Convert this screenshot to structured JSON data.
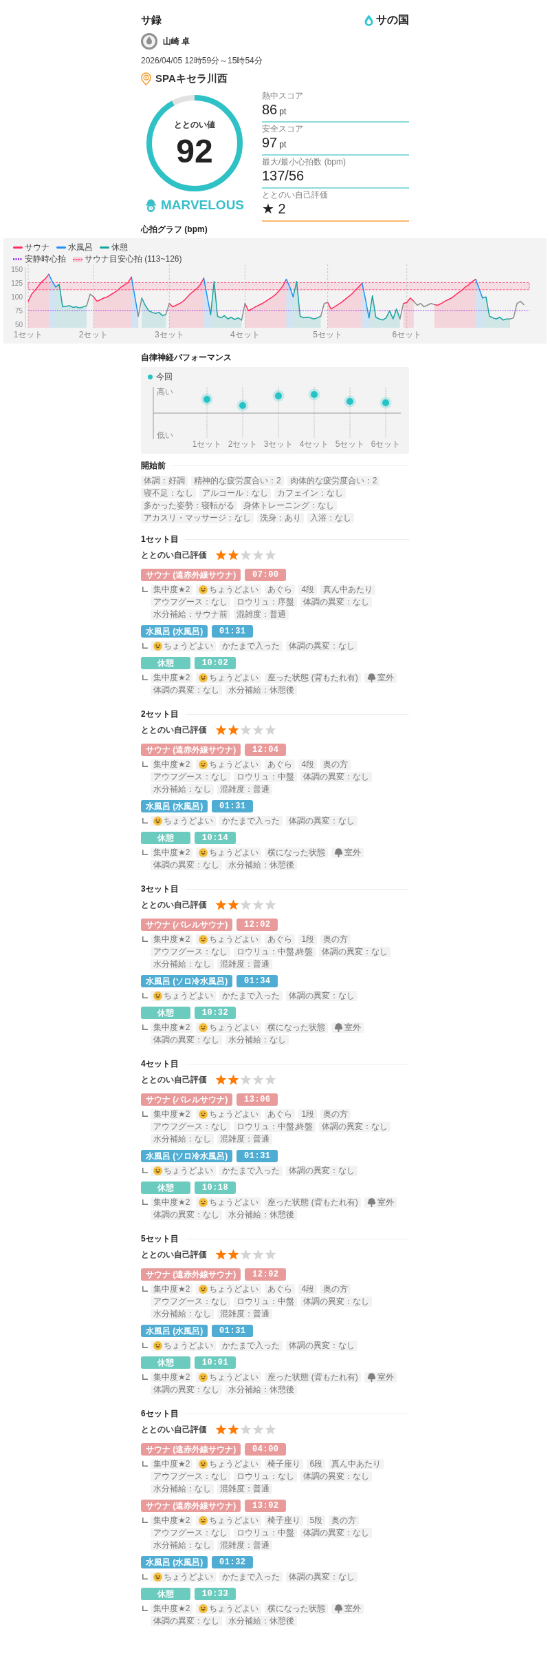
{
  "header": {
    "title": "サ録",
    "logo": "サの国"
  },
  "user": {
    "name": "山崎 卓"
  },
  "session": {
    "datetime": "2026/04/05 12時59分～15時54分",
    "facility": "SPAキセラ川西"
  },
  "score": {
    "label": "ととのい値",
    "value": "92",
    "level": 0.92,
    "rank": "MARVELOUS"
  },
  "metrics": [
    {
      "label": "熱中スコア",
      "value": "86",
      "unit": "pt",
      "color": "#8adbdc"
    },
    {
      "label": "安全スコア",
      "value": "97",
      "unit": "pt",
      "color": "#8adbdc"
    },
    {
      "label": "最大/最小心拍数 (bpm)",
      "value": "137/56",
      "color": "#8adbdc"
    },
    {
      "label": "ととのい自己評価",
      "value": "★ 2",
      "color": "#f8b86a"
    }
  ],
  "heart_rate": {
    "title": "心拍グラフ (bpm)",
    "chart_data": {
      "type": "area",
      "legend": "upper left",
      "categories": [
        "1セット",
        null,
        null,
        null,
        null,
        null,
        null,
        null,
        null,
        null,
        null,
        null,
        null,
        null,
        null,
        null,
        null,
        null,
        null,
        "2セット",
        null,
        null,
        null,
        null,
        null,
        null,
        null,
        null,
        null,
        null,
        null,
        null,
        null,
        null,
        null,
        null,
        null,
        null,
        null,
        null,
        null,
        "3セット",
        null,
        null,
        null,
        null,
        null,
        null,
        null,
        null,
        null,
        null,
        null,
        null,
        null,
        null,
        null,
        null,
        null,
        null,
        null,
        null,
        null,
        "4セット",
        null,
        null,
        null,
        null,
        null,
        null,
        null,
        null,
        null,
        null,
        null,
        null,
        null,
        null,
        null,
        null,
        null,
        null,
        null,
        null,
        null,
        null,
        null,
        "5セット",
        null,
        null,
        null,
        null,
        null,
        null,
        null,
        null,
        null,
        null,
        null,
        null,
        null,
        null,
        null,
        null,
        null,
        null,
        null,
        null,
        null,
        null,
        "6セット",
        null,
        null,
        null,
        null,
        null,
        null,
        null,
        null,
        null,
        null,
        null,
        null,
        null,
        null,
        null,
        null,
        null,
        null,
        null,
        null,
        null,
        null,
        null,
        null,
        null,
        null,
        null,
        null,
        null,
        null,
        null,
        null,
        null,
        null
      ],
      "ylim": [
        44,
        154
      ],
      "yticks": [
        50,
        75,
        100,
        125,
        150
      ],
      "series": [
        {
          "name": "サウナ",
          "color": "#ff2d5f",
          "values": [
            92,
            105,
            112,
            120,
            128,
            133,
            141,
            null,
            null,
            null,
            null,
            null,
            null,
            null,
            null,
            null,
            null,
            null,
            null,
            100,
            92,
            95,
            98,
            100,
            104,
            108,
            112,
            118,
            122,
            126,
            136,
            null,
            null,
            null,
            null,
            null,
            null,
            null,
            null,
            null,
            null,
            88,
            82,
            85,
            88,
            92,
            98,
            105,
            110,
            115,
            122,
            134,
            null,
            null,
            null,
            null,
            null,
            null,
            null,
            null,
            null,
            null,
            null,
            88,
            75,
            78,
            82,
            85,
            88,
            92,
            96,
            100,
            105,
            112,
            120,
            132,
            null,
            null,
            null,
            null,
            null,
            null,
            null,
            null,
            null,
            null,
            null,
            90,
            78,
            82,
            86,
            90,
            95,
            100,
            105,
            112,
            118,
            125,
            null,
            null,
            null,
            null,
            null,
            null,
            null,
            null,
            null,
            null,
            null,
            88,
            90,
            98,
            92,
            null,
            null,
            null,
            null,
            null,
            86,
            85,
            88,
            92,
            95,
            98,
            103,
            108,
            112,
            118,
            122,
            128,
            132,
            null,
            null,
            null,
            null,
            null,
            null,
            null,
            null,
            null,
            null,
            null,
            null,
            null,
            null
          ]
        },
        {
          "name": "水風呂",
          "color": "#1e8ff5",
          "values": [
            null,
            null,
            null,
            null,
            null,
            null,
            141,
            128,
            118,
            null,
            null,
            null,
            null,
            null,
            null,
            null,
            null,
            null,
            null,
            null,
            null,
            null,
            null,
            null,
            null,
            null,
            null,
            null,
            null,
            null,
            136,
            100,
            65,
            null,
            null,
            null,
            null,
            null,
            null,
            null,
            null,
            null,
            null,
            null,
            null,
            null,
            null,
            null,
            null,
            null,
            null,
            134,
            100,
            68,
            null,
            null,
            null,
            null,
            null,
            null,
            null,
            null,
            null,
            null,
            null,
            null,
            null,
            null,
            null,
            null,
            null,
            null,
            null,
            null,
            null,
            132,
            118,
            100,
            null,
            null,
            null,
            null,
            null,
            null,
            null,
            null,
            null,
            null,
            null,
            null,
            null,
            null,
            null,
            null,
            null,
            null,
            null,
            125,
            95,
            62,
            null,
            null,
            null,
            null,
            null,
            null,
            null,
            null,
            null,
            null,
            null,
            null,
            null,
            null,
            null,
            null,
            null,
            null,
            null,
            null,
            null,
            null,
            null,
            null,
            null,
            null,
            null,
            null,
            null,
            null,
            132,
            115,
            98,
            null,
            null,
            null,
            null,
            null,
            null,
            null,
            null,
            null,
            null,
            null,
            null
          ]
        },
        {
          "name": "休憩",
          "color": "#17a39f",
          "values": [
            null,
            null,
            null,
            null,
            null,
            null,
            null,
            null,
            118,
            123,
            82,
            83,
            84,
            81,
            82,
            80,
            82,
            84,
            null,
            null,
            null,
            null,
            null,
            null,
            null,
            null,
            null,
            null,
            null,
            null,
            null,
            null,
            null,
            98,
            85,
            75,
            72,
            70,
            72,
            66,
            68,
            null,
            null,
            null,
            null,
            null,
            null,
            null,
            null,
            null,
            null,
            null,
            null,
            68,
            128,
            65,
            62,
            66,
            60,
            63,
            59,
            62,
            58,
            null,
            null,
            null,
            null,
            null,
            null,
            null,
            null,
            null,
            null,
            null,
            null,
            null,
            null,
            100,
            128,
            65,
            62,
            63,
            62,
            60,
            62,
            65,
            null,
            null,
            null,
            null,
            null,
            null,
            null,
            null,
            null,
            null,
            null,
            null,
            null,
            62,
            102,
            63,
            60,
            58,
            62,
            75,
            60,
            78,
            60,
            null,
            null,
            null,
            null,
            null,
            null,
            null,
            null,
            null,
            null,
            null,
            null,
            null,
            null,
            null,
            null,
            null,
            null,
            null,
            null,
            null,
            null,
            null,
            98,
            100,
            65,
            62,
            60,
            63,
            58,
            60,
            60,
            null,
            null,
            null,
            null
          ]
        },
        {
          "type": "line",
          "color": "#8c8c8c",
          "values": [
            null,
            null,
            null,
            null,
            null,
            null,
            null,
            null,
            null,
            null,
            null,
            null,
            null,
            null,
            null,
            null,
            null,
            84,
            105,
            100,
            null,
            null,
            null,
            null,
            null,
            null,
            null,
            null,
            null,
            null,
            null,
            null,
            65,
            98,
            null,
            null,
            null,
            null,
            null,
            null,
            68,
            88,
            null,
            null,
            null,
            null,
            null,
            null,
            null,
            null,
            null,
            null,
            null,
            null,
            null,
            null,
            null,
            null,
            null,
            null,
            null,
            null,
            58,
            88,
            null,
            null,
            null,
            null,
            null,
            null,
            null,
            null,
            null,
            null,
            null,
            null,
            null,
            null,
            null,
            null,
            null,
            null,
            null,
            null,
            null,
            65,
            88,
            90,
            null,
            null,
            null,
            null,
            null,
            null,
            null,
            null,
            null,
            null,
            null,
            null,
            null,
            null,
            null,
            null,
            null,
            null,
            null,
            null,
            60,
            88,
            null,
            null,
            92,
            85,
            88,
            82,
            85,
            88,
            86,
            null,
            null,
            null,
            null,
            null,
            null,
            null,
            null,
            null,
            null,
            null,
            null,
            null,
            null,
            null,
            null,
            null,
            null,
            null,
            null,
            null,
            60,
            62,
            88,
            92,
            86
          ]
        }
      ],
      "ref_lines": [
        {
          "value": 75,
          "axis": "y",
          "label": "安静時心拍",
          "color": "#9b3cf0"
        }
      ],
      "bands": [
        {
          "from": 113,
          "to": 126,
          "axis": "y",
          "label": "サウナ目安心拍 (113~126)",
          "color": "#ff4d7a"
        }
      ]
    }
  },
  "autonomic": {
    "title": "自律神経パフォーマンス",
    "legend": "今回",
    "y_high": "高い",
    "y_low": "低い",
    "x_labels": [
      "1セット",
      "2セット",
      "3セット",
      "4セット",
      "5セット",
      "6セット"
    ]
  },
  "pre_session": {
    "title": "開始前",
    "tags": [
      "体調：好調",
      "精神的な疲労度合い：2",
      "肉体的な疲労度合い：2",
      "寝不足：なし",
      "アルコール：なし",
      "カフェイン：なし",
      "多かった姿勢：寝転がる",
      "身体トレーニング：なし",
      "アカスリ・マッサージ：なし",
      "洗身：あり",
      "入浴：なし"
    ]
  },
  "sets": [
    {
      "title": "1セット目",
      "rating_label": "ととのい自己評価",
      "stars": 2,
      "phases": [
        {
          "kind": "sauna",
          "label": "サウナ (遠赤外線サウナ)",
          "duration": "07:00",
          "tags": [
            {
              "kind": "plain",
              "text": "集中度★2"
            },
            {
              "kind": "mood",
              "text": "ちょうどよい"
            },
            {
              "kind": "plain",
              "text": "あぐら"
            },
            {
              "kind": "plain",
              "text": "4段"
            },
            {
              "kind": "plain",
              "text": "真ん中あたり"
            },
            {
              "kind": "plain",
              "text": "アウフグース：なし"
            },
            {
              "kind": "plain",
              "text": "ロウリュ：序盤"
            },
            {
              "kind": "plain",
              "text": "体調の異変：なし"
            },
            {
              "kind": "plain",
              "text": "水分補給：サウナ前"
            },
            {
              "kind": "plain",
              "text": "混雑度：普通"
            }
          ]
        },
        {
          "kind": "water",
          "label": "水風呂 (水風呂)",
          "duration": "01:31",
          "tags": [
            {
              "kind": "mood",
              "text": "ちょうどよい"
            },
            {
              "kind": "plain",
              "text": "かたまで入った"
            },
            {
              "kind": "plain",
              "text": "体調の異変：なし"
            }
          ]
        },
        {
          "kind": "rest",
          "label": "休憩",
          "duration": "10:02",
          "tags": [
            {
              "kind": "plain",
              "text": "集中度★2"
            },
            {
              "kind": "mood",
              "text": "ちょうどよい"
            },
            {
              "kind": "plain",
              "text": "座った状態 (背もたれ有)"
            },
            {
              "kind": "outdoor",
              "text": "室外"
            },
            {
              "kind": "plain",
              "text": "体調の異変：なし"
            },
            {
              "kind": "plain",
              "text": "水分補給：休憩後"
            }
          ]
        }
      ]
    },
    {
      "title": "2セット目",
      "rating_label": "ととのい自己評価",
      "stars": 2,
      "phases": [
        {
          "kind": "sauna",
          "label": "サウナ (遠赤外線サウナ)",
          "duration": "12:04",
          "tags": [
            {
              "kind": "plain",
              "text": "集中度★2"
            },
            {
              "kind": "mood",
              "text": "ちょうどよい"
            },
            {
              "kind": "plain",
              "text": "あぐら"
            },
            {
              "kind": "plain",
              "text": "4段"
            },
            {
              "kind": "plain",
              "text": "奥の方"
            },
            {
              "kind": "plain",
              "text": "アウフグース：なし"
            },
            {
              "kind": "plain",
              "text": "ロウリュ：中盤"
            },
            {
              "kind": "plain",
              "text": "体調の異変：なし"
            },
            {
              "kind": "plain",
              "text": "水分補給：なし"
            },
            {
              "kind": "plain",
              "text": "混雑度：普通"
            }
          ]
        },
        {
          "kind": "water",
          "label": "水風呂 (水風呂)",
          "duration": "01:31",
          "tags": [
            {
              "kind": "mood",
              "text": "ちょうどよい"
            },
            {
              "kind": "plain",
              "text": "かたまで入った"
            },
            {
              "kind": "plain",
              "text": "体調の異変：なし"
            }
          ]
        },
        {
          "kind": "rest",
          "label": "休憩",
          "duration": "10:14",
          "tags": [
            {
              "kind": "plain",
              "text": "集中度★2"
            },
            {
              "kind": "mood",
              "text": "ちょうどよい"
            },
            {
              "kind": "plain",
              "text": "横になった状態"
            },
            {
              "kind": "outdoor",
              "text": "室外"
            },
            {
              "kind": "plain",
              "text": "体調の異変：なし"
            },
            {
              "kind": "plain",
              "text": "水分補給：休憩後"
            }
          ]
        }
      ]
    },
    {
      "title": "3セット目",
      "rating_label": "ととのい自己評価",
      "stars": 2,
      "phases": [
        {
          "kind": "sauna",
          "label": "サウナ (バレルサウナ)",
          "duration": "12:02",
          "tags": [
            {
              "kind": "plain",
              "text": "集中度★2"
            },
            {
              "kind": "mood",
              "text": "ちょうどよい"
            },
            {
              "kind": "plain",
              "text": "あぐら"
            },
            {
              "kind": "plain",
              "text": "1段"
            },
            {
              "kind": "plain",
              "text": "奥の方"
            },
            {
              "kind": "plain",
              "text": "アウフグース：なし"
            },
            {
              "kind": "plain",
              "text": "ロウリュ：中盤,終盤"
            },
            {
              "kind": "plain",
              "text": "体調の異変：なし"
            },
            {
              "kind": "plain",
              "text": "水分補給：なし"
            },
            {
              "kind": "plain",
              "text": "混雑度：普通"
            }
          ]
        },
        {
          "kind": "water",
          "label": "水風呂 (ソロ冷水風呂)",
          "duration": "01:34",
          "tags": [
            {
              "kind": "mood",
              "text": "ちょうどよい"
            },
            {
              "kind": "plain",
              "text": "かたまで入った"
            },
            {
              "kind": "plain",
              "text": "体調の異変：なし"
            }
          ]
        },
        {
          "kind": "rest",
          "label": "休憩",
          "duration": "10:32",
          "tags": [
            {
              "kind": "plain",
              "text": "集中度★2"
            },
            {
              "kind": "mood",
              "text": "ちょうどよい"
            },
            {
              "kind": "plain",
              "text": "横になった状態"
            },
            {
              "kind": "outdoor",
              "text": "室外"
            },
            {
              "kind": "plain",
              "text": "体調の異変：なし"
            },
            {
              "kind": "plain",
              "text": "水分補給：なし"
            }
          ]
        }
      ]
    },
    {
      "title": "4セット目",
      "rating_label": "ととのい自己評価",
      "stars": 2,
      "phases": [
        {
          "kind": "sauna",
          "label": "サウナ (バレルサウナ)",
          "duration": "13:06",
          "tags": [
            {
              "kind": "plain",
              "text": "集中度★2"
            },
            {
              "kind": "mood",
              "text": "ちょうどよい"
            },
            {
              "kind": "plain",
              "text": "あぐら"
            },
            {
              "kind": "plain",
              "text": "1段"
            },
            {
              "kind": "plain",
              "text": "奥の方"
            },
            {
              "kind": "plain",
              "text": "アウフグース：なし"
            },
            {
              "kind": "plain",
              "text": "ロウリュ：中盤,終盤"
            },
            {
              "kind": "plain",
              "text": "体調の異変：なし"
            },
            {
              "kind": "plain",
              "text": "水分補給：なし"
            },
            {
              "kind": "plain",
              "text": "混雑度：普通"
            }
          ]
        },
        {
          "kind": "water",
          "label": "水風呂 (ソロ冷水風呂)",
          "duration": "01:31",
          "tags": [
            {
              "kind": "mood",
              "text": "ちょうどよい"
            },
            {
              "kind": "plain",
              "text": "かたまで入った"
            },
            {
              "kind": "plain",
              "text": "体調の異変：なし"
            }
          ]
        },
        {
          "kind": "rest",
          "label": "休憩",
          "duration": "10:18",
          "tags": [
            {
              "kind": "plain",
              "text": "集中度★2"
            },
            {
              "kind": "mood",
              "text": "ちょうどよい"
            },
            {
              "kind": "plain",
              "text": "座った状態 (背もたれ有)"
            },
            {
              "kind": "outdoor",
              "text": "室外"
            },
            {
              "kind": "plain",
              "text": "体調の異変：なし"
            },
            {
              "kind": "plain",
              "text": "水分補給：休憩後"
            }
          ]
        }
      ]
    },
    {
      "title": "5セット目",
      "rating_label": "ととのい自己評価",
      "stars": 2,
      "phases": [
        {
          "kind": "sauna",
          "label": "サウナ (遠赤外線サウナ)",
          "duration": "12:02",
          "tags": [
            {
              "kind": "plain",
              "text": "集中度★2"
            },
            {
              "kind": "mood",
              "text": "ちょうどよい"
            },
            {
              "kind": "plain",
              "text": "あぐら"
            },
            {
              "kind": "plain",
              "text": "4段"
            },
            {
              "kind": "plain",
              "text": "奥の方"
            },
            {
              "kind": "plain",
              "text": "アウフグース：なし"
            },
            {
              "kind": "plain",
              "text": "ロウリュ：中盤"
            },
            {
              "kind": "plain",
              "text": "体調の異変：なし"
            },
            {
              "kind": "plain",
              "text": "水分補給：なし"
            },
            {
              "kind": "plain",
              "text": "混雑度：普通"
            }
          ]
        },
        {
          "kind": "water",
          "label": "水風呂 (水風呂)",
          "duration": "01:31",
          "tags": [
            {
              "kind": "mood",
              "text": "ちょうどよい"
            },
            {
              "kind": "plain",
              "text": "かたまで入った"
            },
            {
              "kind": "plain",
              "text": "体調の異変：なし"
            }
          ]
        },
        {
          "kind": "rest",
          "label": "休憩",
          "duration": "10:01",
          "tags": [
            {
              "kind": "plain",
              "text": "集中度★2"
            },
            {
              "kind": "mood",
              "text": "ちょうどよい"
            },
            {
              "kind": "plain",
              "text": "座った状態 (背もたれ有)"
            },
            {
              "kind": "outdoor",
              "text": "室外"
            },
            {
              "kind": "plain",
              "text": "体調の異変：なし"
            },
            {
              "kind": "plain",
              "text": "水分補給：休憩後"
            }
          ]
        }
      ]
    },
    {
      "title": "6セット目",
      "rating_label": "ととのい自己評価",
      "stars": 2,
      "phases": [
        {
          "kind": "sauna",
          "label": "サウナ (遠赤外線サウナ)",
          "duration": "04:00",
          "tags": [
            {
              "kind": "plain",
              "text": "集中度★2"
            },
            {
              "kind": "mood",
              "text": "ちょうどよい"
            },
            {
              "kind": "plain",
              "text": "椅子座り"
            },
            {
              "kind": "plain",
              "text": "6段"
            },
            {
              "kind": "plain",
              "text": "真ん中あたり"
            },
            {
              "kind": "plain",
              "text": "アウフグース：なし"
            },
            {
              "kind": "plain",
              "text": "ロウリュ：なし"
            },
            {
              "kind": "plain",
              "text": "体調の異変：なし"
            },
            {
              "kind": "plain",
              "text": "水分補給：なし"
            },
            {
              "kind": "plain",
              "text": "混雑度：普通"
            }
          ]
        },
        {
          "kind": "sauna",
          "label": "サウナ (遠赤外線サウナ)",
          "duration": "13:02",
          "tags": [
            {
              "kind": "plain",
              "text": "集中度★2"
            },
            {
              "kind": "mood",
              "text": "ちょうどよい"
            },
            {
              "kind": "plain",
              "text": "椅子座り"
            },
            {
              "kind": "plain",
              "text": "5段"
            },
            {
              "kind": "plain",
              "text": "奥の方"
            },
            {
              "kind": "plain",
              "text": "アウフグース：なし"
            },
            {
              "kind": "plain",
              "text": "ロウリュ：中盤"
            },
            {
              "kind": "plain",
              "text": "体調の異変：なし"
            },
            {
              "kind": "plain",
              "text": "水分補給：なし"
            },
            {
              "kind": "plain",
              "text": "混雑度：普通"
            }
          ]
        },
        {
          "kind": "water",
          "label": "水風呂 (水風呂)",
          "duration": "01:32",
          "tags": [
            {
              "kind": "mood",
              "text": "ちょうどよい"
            },
            {
              "kind": "plain",
              "text": "かたまで入った"
            },
            {
              "kind": "plain",
              "text": "体調の異変：なし"
            }
          ]
        },
        {
          "kind": "rest",
          "label": "休憩",
          "duration": "10:33",
          "tags": [
            {
              "kind": "plain",
              "text": "集中度★2"
            },
            {
              "kind": "mood",
              "text": "ちょうどよい"
            },
            {
              "kind": "plain",
              "text": "横になった状態"
            },
            {
              "kind": "outdoor",
              "text": "室外"
            },
            {
              "kind": "plain",
              "text": "体調の異変：なし"
            },
            {
              "kind": "plain",
              "text": "水分補給：休憩後"
            }
          ]
        }
      ]
    }
  ]
}
